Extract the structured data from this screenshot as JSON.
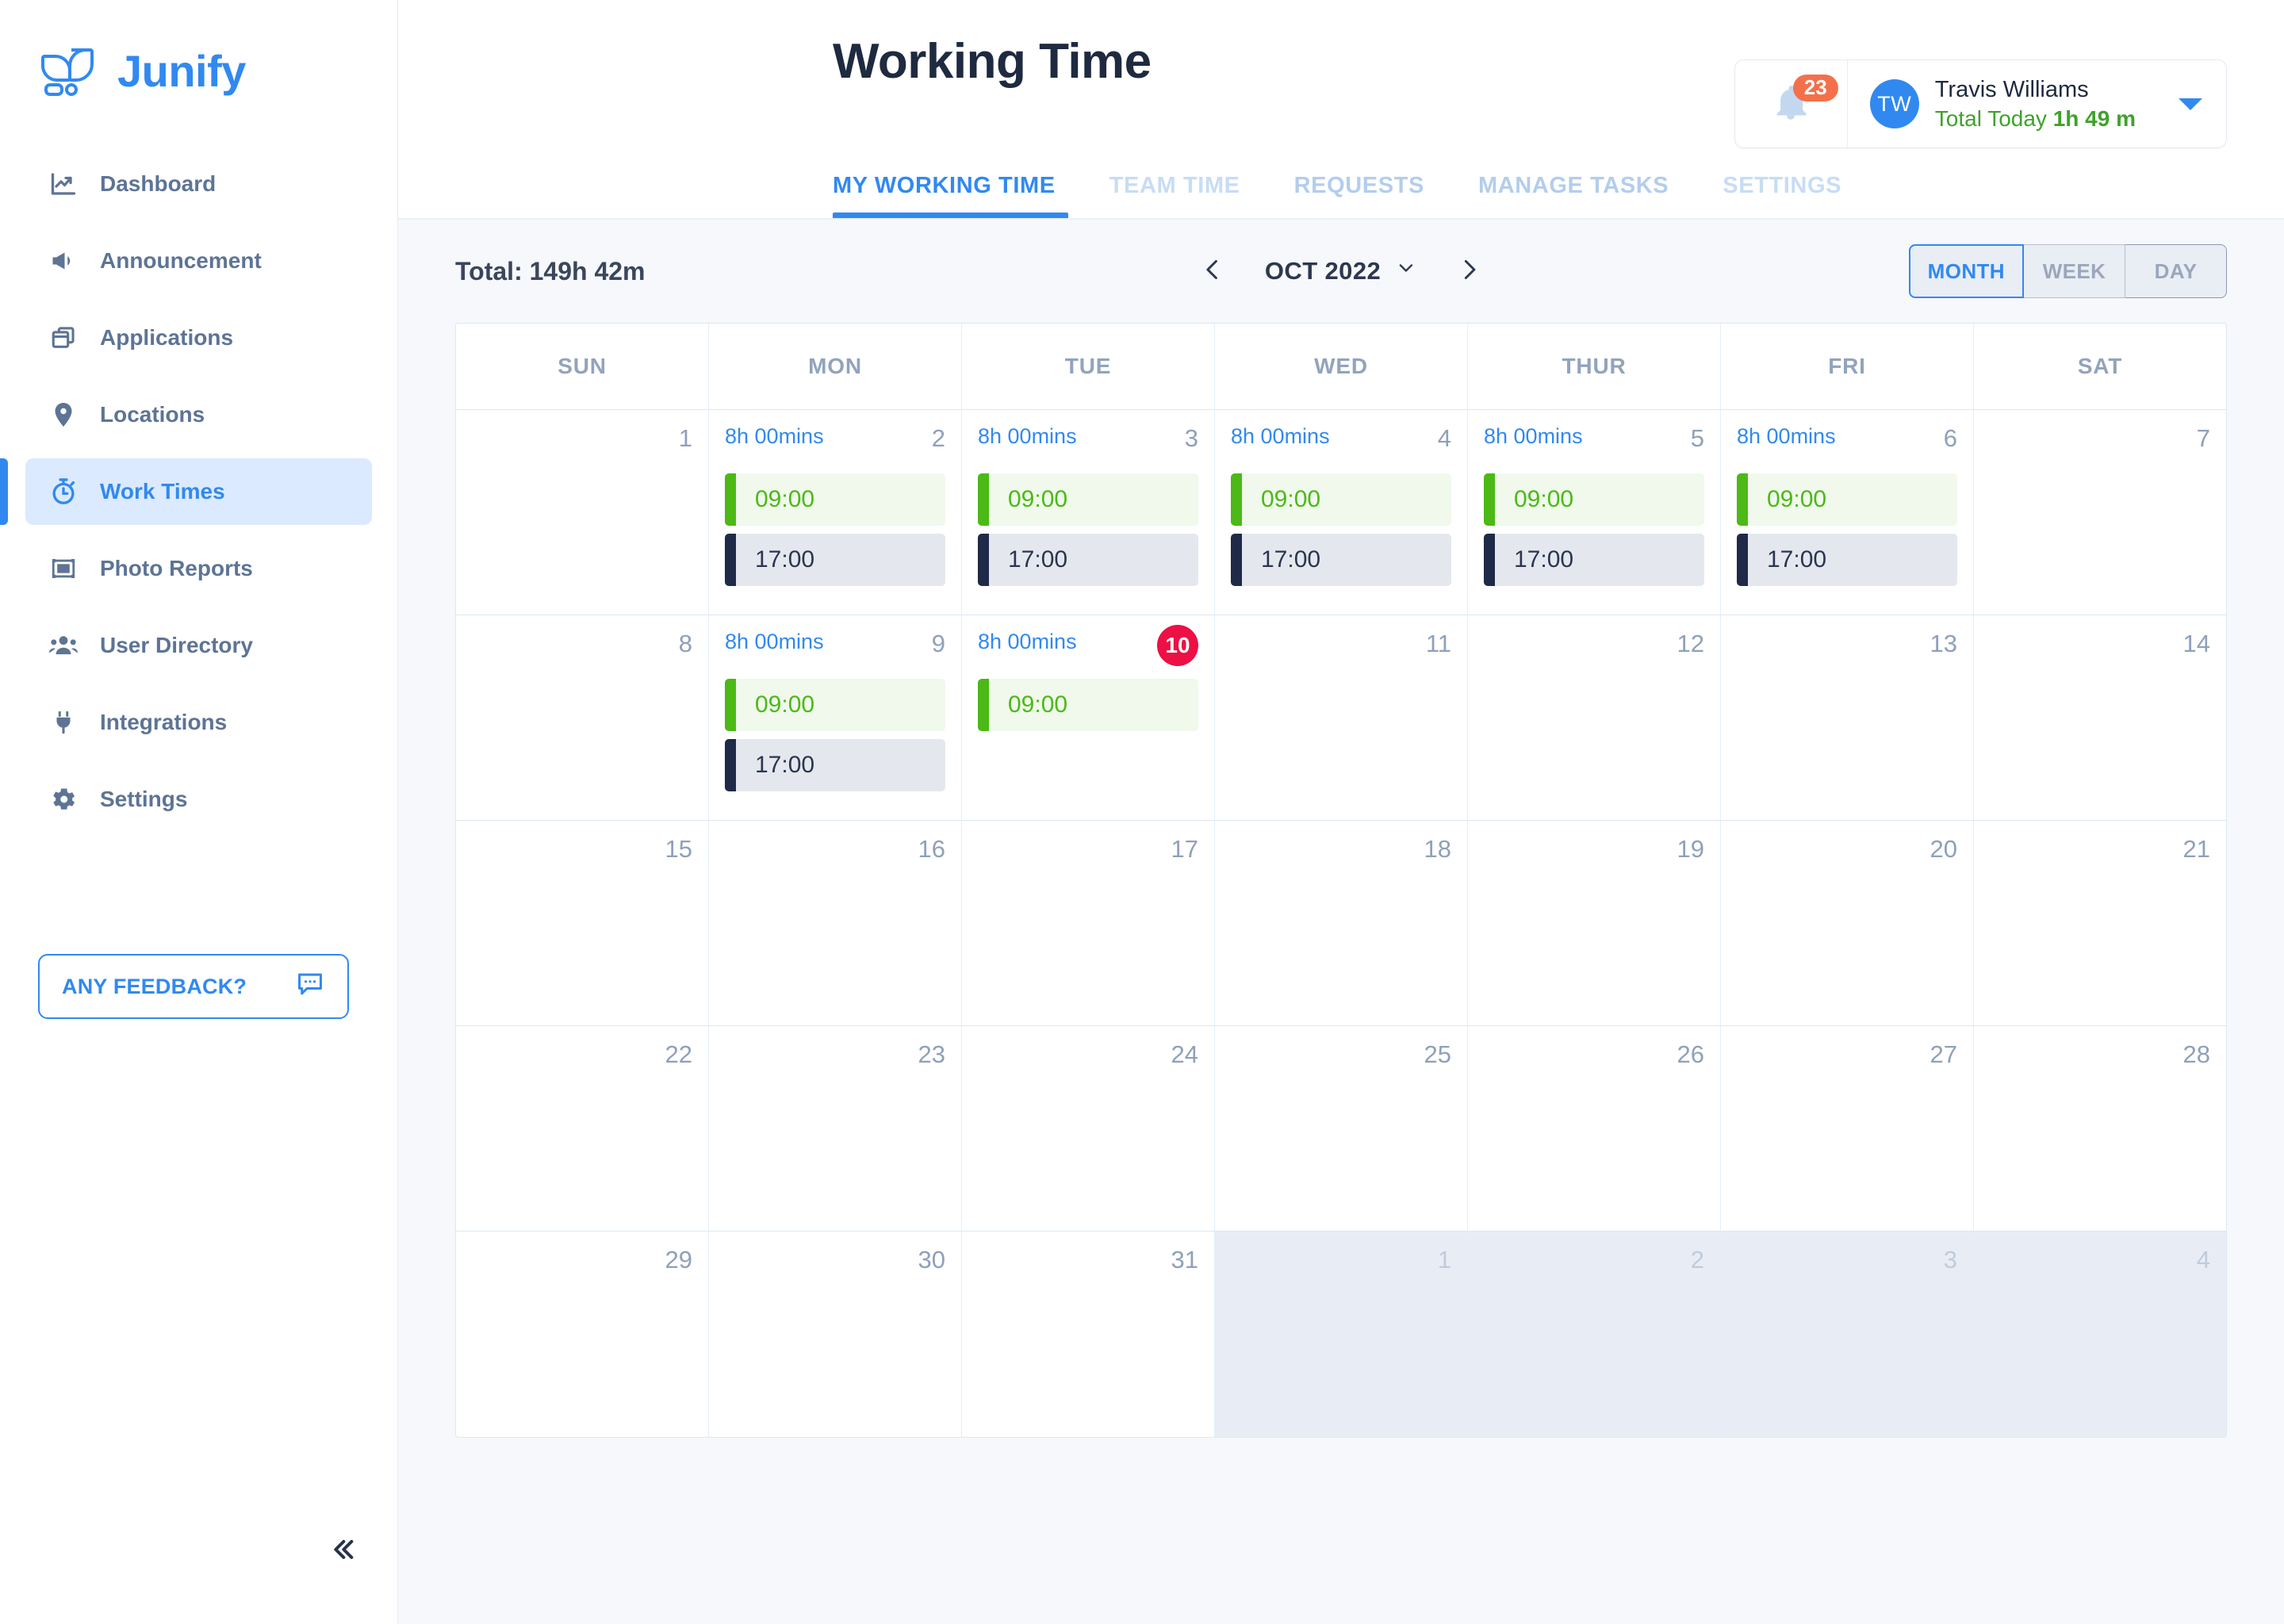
{
  "brand": {
    "name": "Junify",
    "logo_icon": "junify-leaf-logo",
    "color": "#3189f0"
  },
  "sidebar": {
    "items": [
      {
        "label": "Dashboard",
        "icon": "chart-line-icon",
        "active": false
      },
      {
        "label": "Announcement",
        "icon": "megaphone-icon",
        "active": false
      },
      {
        "label": "Applications",
        "icon": "windows-stack-icon",
        "active": false
      },
      {
        "label": "Locations",
        "icon": "map-pin-icon",
        "active": false
      },
      {
        "label": "Work Times",
        "icon": "stopwatch-icon",
        "active": true
      },
      {
        "label": "Photo Reports",
        "icon": "photo-frame-icon",
        "active": false
      },
      {
        "label": "User Directory",
        "icon": "users-group-icon",
        "active": false
      },
      {
        "label": "Integrations",
        "icon": "plug-icon",
        "active": false
      },
      {
        "label": "Settings",
        "icon": "gear-icon",
        "active": false
      }
    ],
    "feedback_label": "ANY FEEDBACK?",
    "feedback_icon": "chat-bubble-dots-icon",
    "collapse_icon": "double-chevron-left-icon"
  },
  "header": {
    "title": "Working Time",
    "notifications": {
      "icon": "bell-icon",
      "count": "23",
      "badge_color": "#f4704a"
    },
    "user": {
      "initials": "TW",
      "name": "Travis Williams",
      "total_today_label": "Total Today",
      "total_today_value": "1h 49 m",
      "total_color": "#3fa22b",
      "caret_icon": "chevron-down-icon"
    },
    "tabs": [
      {
        "label": "MY WORKING TIME",
        "active": true
      },
      {
        "label": "TEAM TIME",
        "active": false
      },
      {
        "label": "REQUESTS",
        "active": false
      },
      {
        "label": "MANAGE TASKS",
        "active": false
      },
      {
        "label": "SETTINGS",
        "active": false
      }
    ]
  },
  "toolbar": {
    "total": "Total: 149h 42m",
    "prev_icon": "chevron-left-icon",
    "next_icon": "chevron-right-icon",
    "month_label": "OCT 2022",
    "month_caret_icon": "chevron-down-icon",
    "views": [
      {
        "label": "MONTH",
        "active": true
      },
      {
        "label": "WEEK",
        "active": false
      },
      {
        "label": "DAY",
        "active": false
      }
    ]
  },
  "calendar": {
    "weekday_headers": [
      "SUN",
      "MON",
      "TUE",
      "WED",
      "THUR",
      "FRI",
      "SAT"
    ],
    "weeks": [
      [
        {
          "day": "1",
          "other": false,
          "today": false,
          "hours": "",
          "entries": []
        },
        {
          "day": "2",
          "other": false,
          "today": false,
          "hours": "8h 00mins",
          "entries": [
            {
              "type": "in",
              "time": "09:00"
            },
            {
              "type": "out",
              "time": "17:00"
            }
          ]
        },
        {
          "day": "3",
          "other": false,
          "today": false,
          "hours": "8h 00mins",
          "entries": [
            {
              "type": "in",
              "time": "09:00"
            },
            {
              "type": "out",
              "time": "17:00"
            }
          ]
        },
        {
          "day": "4",
          "other": false,
          "today": false,
          "hours": "8h 00mins",
          "entries": [
            {
              "type": "in",
              "time": "09:00"
            },
            {
              "type": "out",
              "time": "17:00"
            }
          ]
        },
        {
          "day": "5",
          "other": false,
          "today": false,
          "hours": "8h 00mins",
          "entries": [
            {
              "type": "in",
              "time": "09:00"
            },
            {
              "type": "out",
              "time": "17:00"
            }
          ]
        },
        {
          "day": "6",
          "other": false,
          "today": false,
          "hours": "8h 00mins",
          "entries": [
            {
              "type": "in",
              "time": "09:00"
            },
            {
              "type": "out",
              "time": "17:00"
            }
          ]
        },
        {
          "day": "7",
          "other": false,
          "today": false,
          "hours": "",
          "entries": []
        }
      ],
      [
        {
          "day": "8",
          "other": false,
          "today": false,
          "hours": "",
          "entries": []
        },
        {
          "day": "9",
          "other": false,
          "today": false,
          "hours": "8h 00mins",
          "entries": [
            {
              "type": "in",
              "time": "09:00"
            },
            {
              "type": "out",
              "time": "17:00"
            }
          ]
        },
        {
          "day": "10",
          "other": false,
          "today": true,
          "hours": "8h 00mins",
          "entries": [
            {
              "type": "in",
              "time": "09:00"
            }
          ]
        },
        {
          "day": "11",
          "other": false,
          "today": false,
          "hours": "",
          "entries": []
        },
        {
          "day": "12",
          "other": false,
          "today": false,
          "hours": "",
          "entries": []
        },
        {
          "day": "13",
          "other": false,
          "today": false,
          "hours": "",
          "entries": []
        },
        {
          "day": "14",
          "other": false,
          "today": false,
          "hours": "",
          "entries": []
        }
      ],
      [
        {
          "day": "15",
          "other": false,
          "today": false,
          "hours": "",
          "entries": []
        },
        {
          "day": "16",
          "other": false,
          "today": false,
          "hours": "",
          "entries": []
        },
        {
          "day": "17",
          "other": false,
          "today": false,
          "hours": "",
          "entries": []
        },
        {
          "day": "18",
          "other": false,
          "today": false,
          "hours": "",
          "entries": []
        },
        {
          "day": "19",
          "other": false,
          "today": false,
          "hours": "",
          "entries": []
        },
        {
          "day": "20",
          "other": false,
          "today": false,
          "hours": "",
          "entries": []
        },
        {
          "day": "21",
          "other": false,
          "today": false,
          "hours": "",
          "entries": []
        }
      ],
      [
        {
          "day": "22",
          "other": false,
          "today": false,
          "hours": "",
          "entries": []
        },
        {
          "day": "23",
          "other": false,
          "today": false,
          "hours": "",
          "entries": []
        },
        {
          "day": "24",
          "other": false,
          "today": false,
          "hours": "",
          "entries": []
        },
        {
          "day": "25",
          "other": false,
          "today": false,
          "hours": "",
          "entries": []
        },
        {
          "day": "26",
          "other": false,
          "today": false,
          "hours": "",
          "entries": []
        },
        {
          "day": "27",
          "other": false,
          "today": false,
          "hours": "",
          "entries": []
        },
        {
          "day": "28",
          "other": false,
          "today": false,
          "hours": "",
          "entries": []
        }
      ],
      [
        {
          "day": "29",
          "other": false,
          "today": false,
          "hours": "",
          "entries": []
        },
        {
          "day": "30",
          "other": false,
          "today": false,
          "hours": "",
          "entries": []
        },
        {
          "day": "31",
          "other": false,
          "today": false,
          "hours": "",
          "entries": []
        },
        {
          "day": "1",
          "other": true,
          "today": false,
          "hours": "",
          "entries": []
        },
        {
          "day": "2",
          "other": true,
          "today": false,
          "hours": "",
          "entries": []
        },
        {
          "day": "3",
          "other": true,
          "today": false,
          "hours": "",
          "entries": []
        },
        {
          "day": "4",
          "other": true,
          "today": false,
          "hours": "",
          "entries": []
        }
      ]
    ]
  }
}
